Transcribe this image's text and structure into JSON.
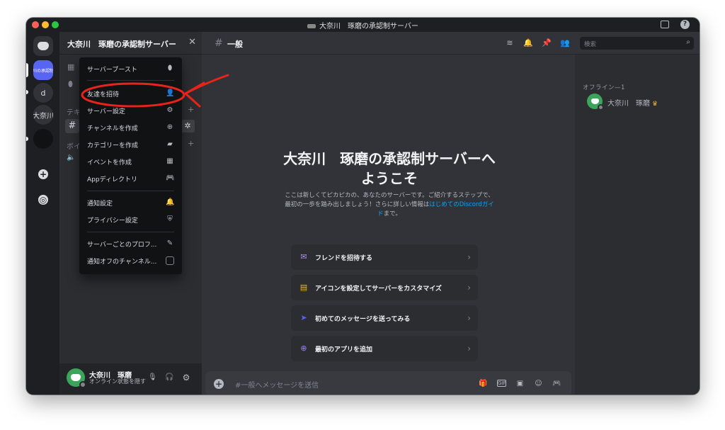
{
  "window": {
    "title": "大奈川　琢磨の承認制サーバー"
  },
  "rail": {
    "active_server_label": "川の承認制",
    "server_d_label": "d",
    "server_name_label": "大奈川",
    "add_icon": "plus-icon",
    "explore_icon": "compass-icon"
  },
  "sidebar": {
    "server_title": "大奈川　琢磨の承認制サーバー",
    "close": "✕",
    "text_category_partial": "テキ",
    "voice_category_partial": "ボイ"
  },
  "menu": {
    "items": [
      {
        "label": "サーバーブースト",
        "icon": "boost-icon"
      },
      {
        "label": "友達を招待",
        "icon": "add-friend-icon"
      },
      {
        "label": "サーバー設定",
        "icon": "gear-icon"
      },
      {
        "label": "チャンネルを作成",
        "icon": "plus-circle-icon"
      },
      {
        "label": "カテゴリーを作成",
        "icon": "folder-plus-icon"
      },
      {
        "label": "イベントを作成",
        "icon": "calendar-plus-icon"
      },
      {
        "label": "Appディレクトリ",
        "icon": "gamepad-icon"
      },
      {
        "label": "通知設定",
        "icon": "bell-icon"
      },
      {
        "label": "プライバシー設定",
        "icon": "shield-icon"
      },
      {
        "label": "サーバーごとのプロフ...",
        "icon": "pencil-icon"
      },
      {
        "label": "通知オフのチャンネル...",
        "icon": "checkbox"
      }
    ]
  },
  "user": {
    "name": "大奈川　琢磨",
    "status": "オンライン状態を隠す"
  },
  "channel": {
    "hash": "#",
    "name": "一般"
  },
  "welcome": {
    "title": "大奈川　琢磨の承認制サーバーへようこそ",
    "desc_part1": "ここは新しくてピカピカの、あなたのサーバーです。ご紹介するステップで、最初の一歩を踏み出しましょう！さらに詳しい情報は",
    "desc_link": "はじめてのDiscordガイド",
    "desc_part2": "まで。",
    "cards": [
      {
        "label": "フレンドを招待する",
        "icon": "invite-icon",
        "color": "#b48cf2"
      },
      {
        "label": "アイコンを設定してサーバーをカスタマイズ",
        "icon": "palette-icon",
        "color": "#f0b232"
      },
      {
        "label": "初めてのメッセージを送ってみる",
        "icon": "send-icon",
        "color": "#5865f2"
      },
      {
        "label": "最初のアプリを追加",
        "icon": "app-icon",
        "color": "#9b84ec"
      }
    ]
  },
  "composer": {
    "placeholder": "#一般へメッセージを送信"
  },
  "members": {
    "search_placeholder": "検索",
    "section": "オフライン—1",
    "member_name": "大奈川　琢磨"
  },
  "colors": {
    "annotation": "#e8231b",
    "accent": "#5865f2",
    "online_green": "#3ba55c"
  }
}
